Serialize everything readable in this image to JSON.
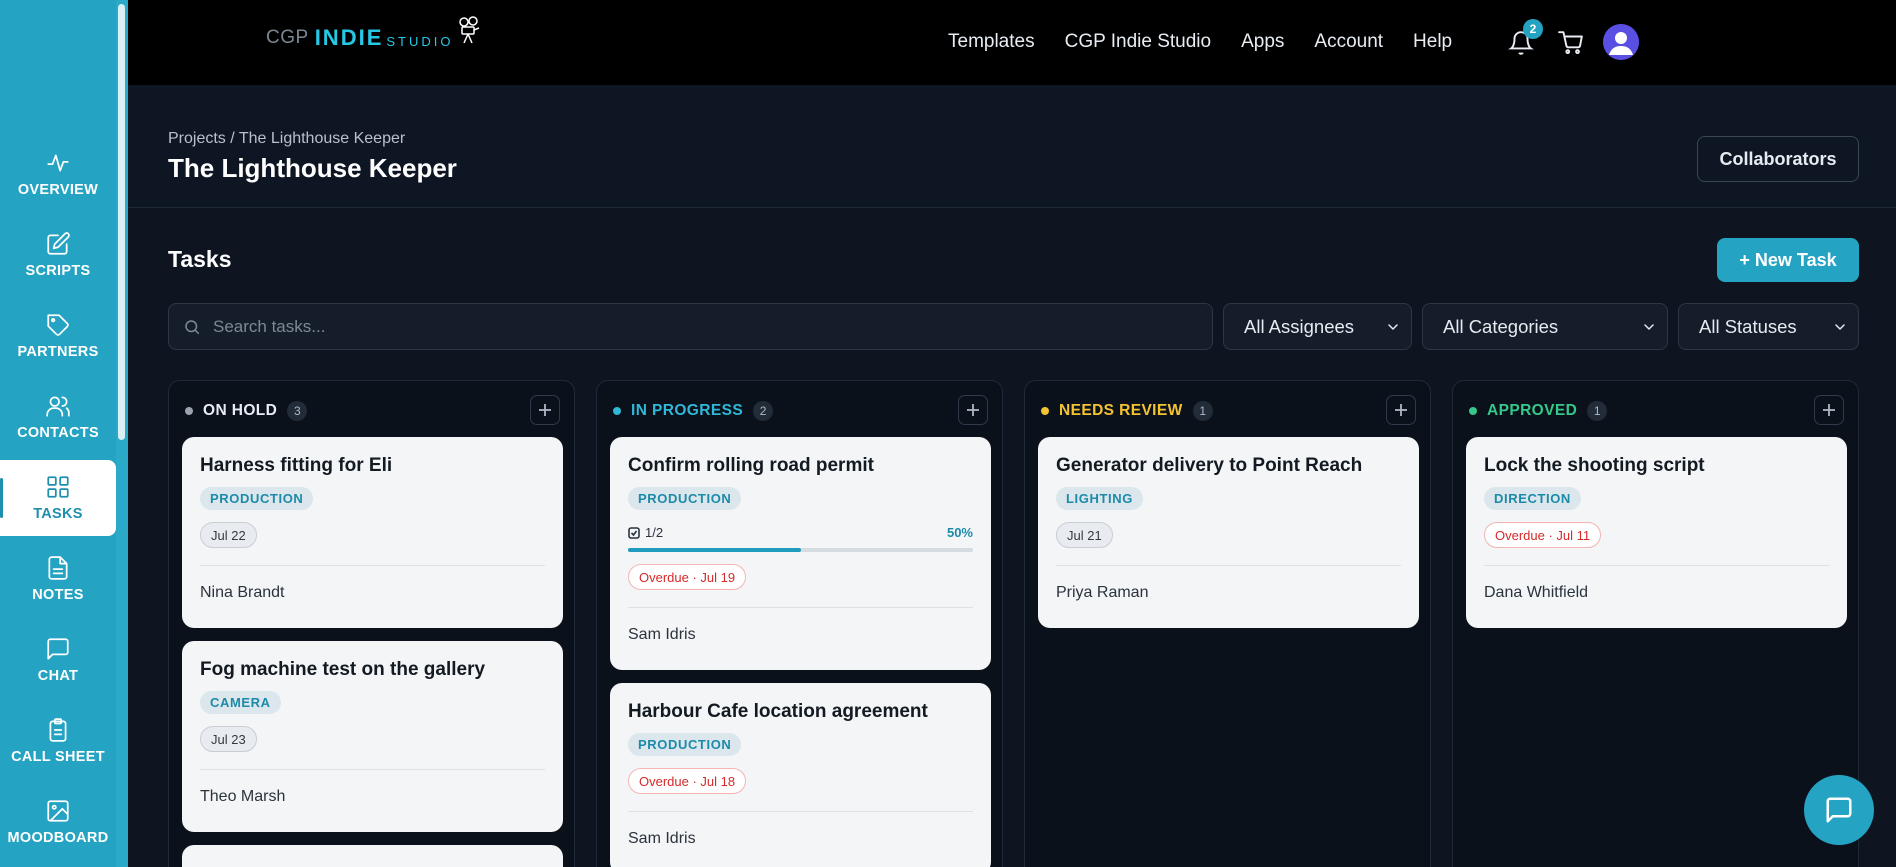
{
  "sidebar": {
    "items": [
      {
        "label": "OVERVIEW",
        "icon": "activity-icon"
      },
      {
        "label": "SCRIPTS",
        "icon": "edit-icon"
      },
      {
        "label": "PARTNERS",
        "icon": "tag-icon"
      },
      {
        "label": "CONTACTS",
        "icon": "users-icon"
      },
      {
        "label": "TASKS",
        "icon": "grid-icon"
      },
      {
        "label": "NOTES",
        "icon": "file-text-icon"
      },
      {
        "label": "CHAT",
        "icon": "message-icon"
      },
      {
        "label": "CALL SHEET",
        "icon": "clipboard-icon"
      },
      {
        "label": "MOODBOARD",
        "icon": "image-icon"
      }
    ],
    "active_index": 4
  },
  "topbar": {
    "logo": {
      "part1": "CGP",
      "part2": "INDIE",
      "part3": "STUDIO"
    },
    "nav": [
      "Templates",
      "CGP Indie Studio",
      "Apps",
      "Account",
      "Help"
    ],
    "notification_count": "2"
  },
  "project": {
    "breadcrumb": "Projects / The Lighthouse Keeper",
    "title": "The Lighthouse Keeper",
    "collaborators_label": "Collaborators"
  },
  "tasks": {
    "title": "Tasks",
    "new_task_label": "+ New Task",
    "search_placeholder": "Search tasks...",
    "filters": {
      "assignees": "All Assignees",
      "categories": "All Categories",
      "statuses": "All Statuses"
    }
  },
  "columns": [
    {
      "title": "ON HOLD",
      "count": "3",
      "color": "#9aa3ae",
      "cards": [
        {
          "title": "Harness fitting for Eli",
          "tag": "PRODUCTION",
          "date": "Jul 22",
          "assignee": "Nina Brandt"
        },
        {
          "title": "Fog machine test on the gallery",
          "tag": "CAMERA",
          "date": "Jul 23",
          "assignee": "Theo Marsh"
        }
      ]
    },
    {
      "title": "IN PROGRESS",
      "count": "2",
      "color": "#2fb8d8",
      "cards": [
        {
          "title": "Confirm rolling road permit",
          "tag": "PRODUCTION",
          "checklist": "1/2",
          "progress": "50%",
          "progress_value": 0.5,
          "overdue": "Overdue · Jul 19",
          "assignee": "Sam Idris"
        },
        {
          "title": "Harbour Cafe location agreement",
          "tag": "PRODUCTION",
          "overdue": "Overdue · Jul 18",
          "assignee": "Sam Idris"
        }
      ]
    },
    {
      "title": "NEEDS REVIEW",
      "count": "1",
      "color": "#f4c430",
      "cards": [
        {
          "title": "Generator delivery to Point Reach",
          "tag": "LIGHTING",
          "date": "Jul 21",
          "assignee": "Priya Raman"
        }
      ]
    },
    {
      "title": "APPROVED",
      "count": "1",
      "color": "#34c98a",
      "cards": [
        {
          "title": "Lock the shooting script",
          "tag": "DIRECTION",
          "overdue": "Overdue · Jul 11",
          "assignee": "Dana Whitfield"
        }
      ]
    }
  ]
}
